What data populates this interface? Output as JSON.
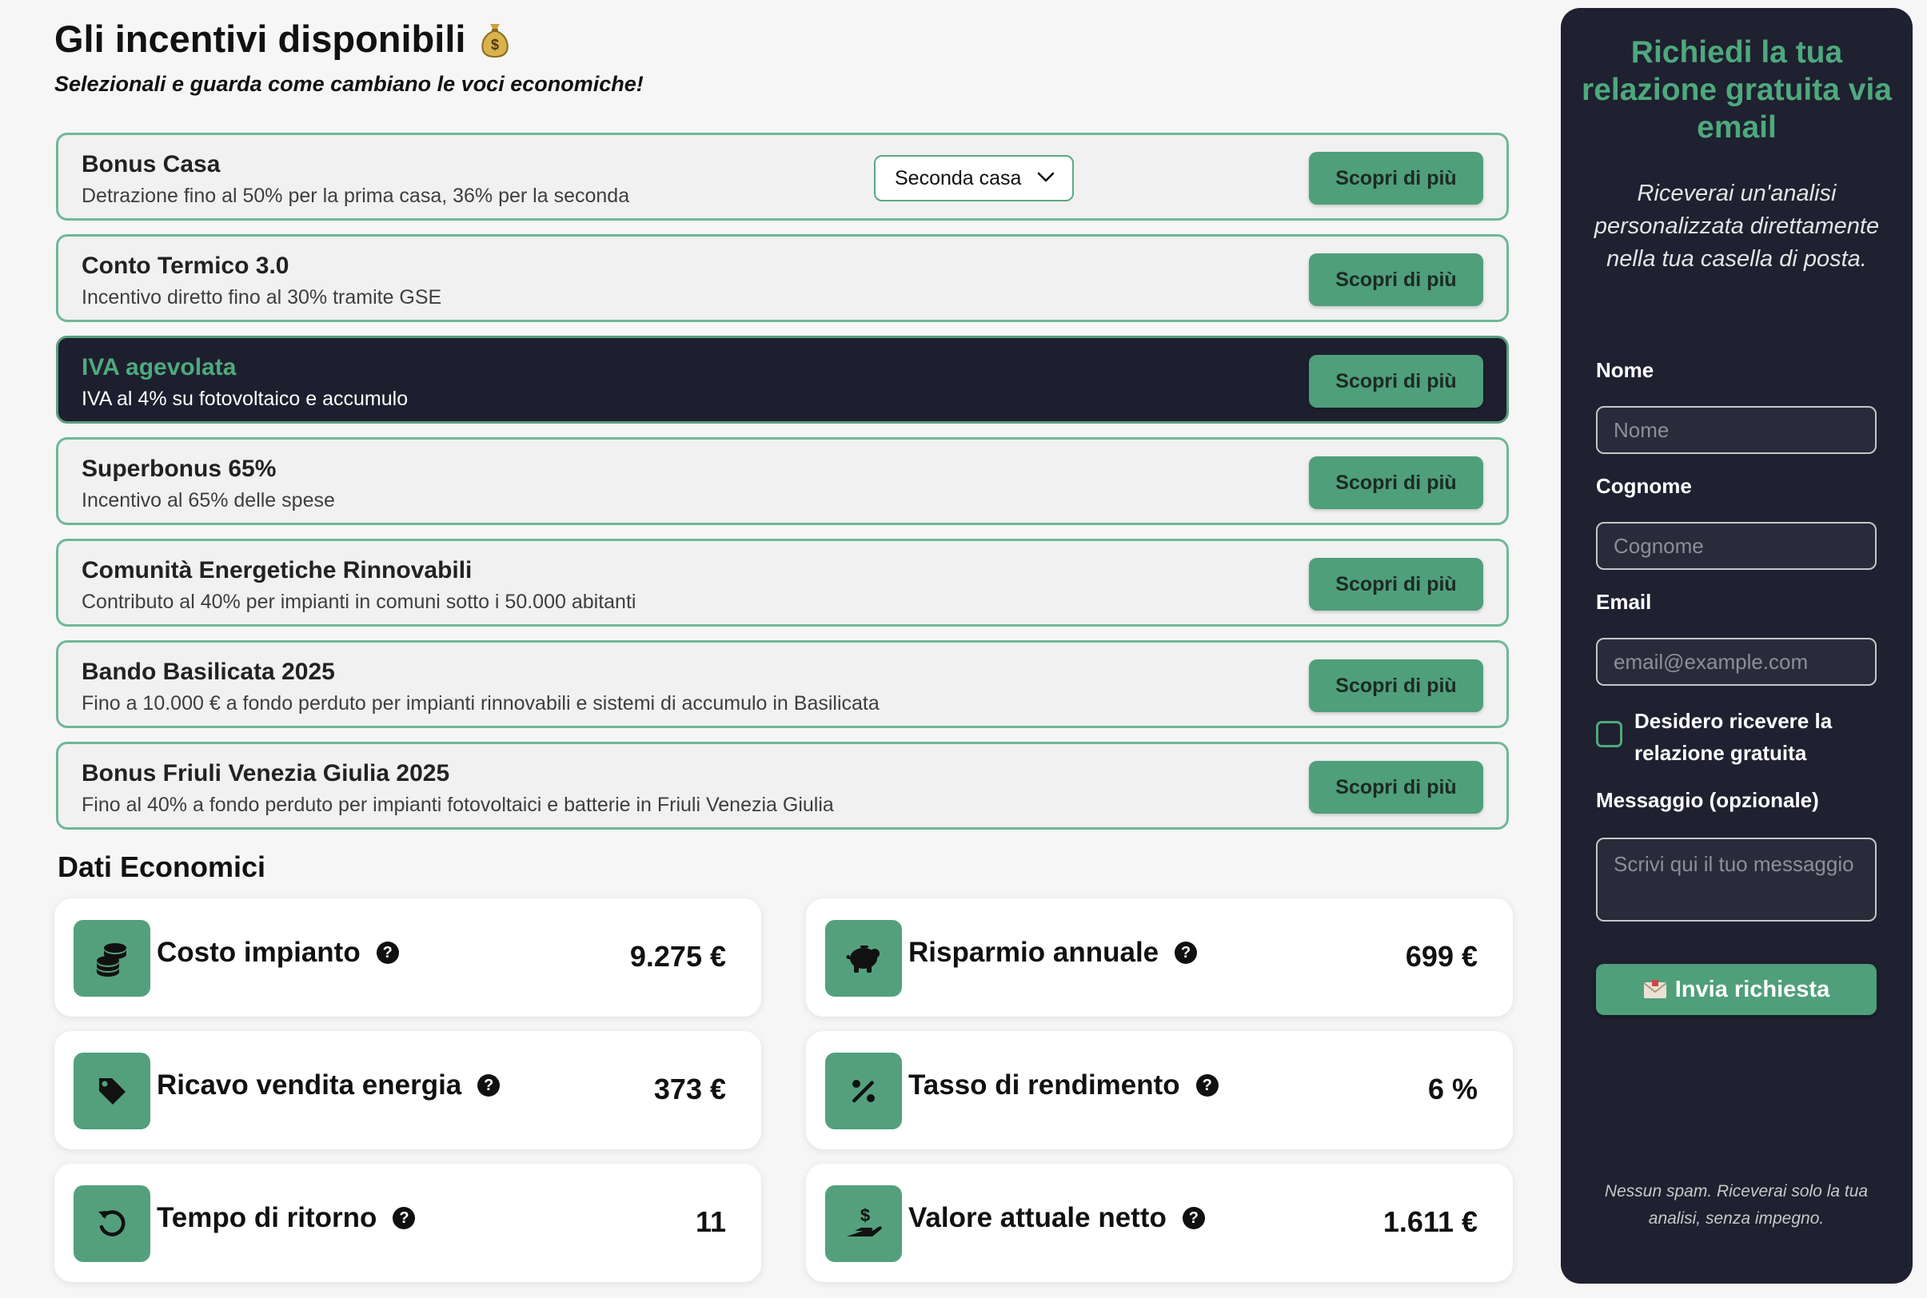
{
  "header": {
    "title": "Gli incentivi disponibili",
    "subtitle": "Selezionali e guarda come cambiano le voci economiche!"
  },
  "incentives": [
    {
      "title": "Bonus Casa",
      "description": "Detrazione fino al 50% per la prima casa, 36% per la seconda",
      "button": "Scopri di più",
      "dropdown": "Seconda casa",
      "active": false
    },
    {
      "title": "Conto Termico 3.0",
      "description": "Incentivo diretto fino al 30% tramite GSE",
      "button": "Scopri di più",
      "active": false
    },
    {
      "title": "IVA agevolata",
      "description": "IVA al 4% su fotovoltaico e accumulo",
      "button": "Scopri di più",
      "active": true
    },
    {
      "title": "Superbonus 65%",
      "description": "Incentivo al 65% delle spese",
      "button": "Scopri di più",
      "active": false
    },
    {
      "title": "Comunità Energetiche Rinnovabili",
      "description": "Contributo al 40% per impianti in comuni sotto i 50.000 abitanti",
      "button": "Scopri di più",
      "active": false
    },
    {
      "title": "Bando Basilicata 2025",
      "description": "Fino a 10.000 € a fondo perduto per impianti rinnovabili e sistemi di accumulo in Basilicata",
      "button": "Scopri di più",
      "active": false
    },
    {
      "title": "Bonus Friuli Venezia Giulia 2025",
      "description": "Fino al 40% a fondo perduto per impianti fotovoltaici e batterie in Friuli Venezia Giulia",
      "button": "Scopri di più",
      "active": false
    }
  ],
  "dati": {
    "title": "Dati Economici",
    "cards": [
      {
        "label": "Costo impianto",
        "value": "9.275 €",
        "icon": "coins-icon"
      },
      {
        "label": "Risparmio annuale",
        "value": "699 €",
        "icon": "piggy-bank-icon"
      },
      {
        "label": "Ricavo vendita energia",
        "value": "373 €",
        "icon": "tag-icon"
      },
      {
        "label": "Tasso di rendimento",
        "value": "6 %",
        "icon": "percent-icon"
      },
      {
        "label": "Tempo di ritorno",
        "value": "11",
        "icon": "rotate-left-icon"
      },
      {
        "label": "Valore attuale netto",
        "value": "1.611 €",
        "icon": "hand-dollar-icon"
      }
    ]
  },
  "sidebar": {
    "title": "Richiedi la tua relazione gratuita via email",
    "intro": "Riceverai un'analisi personalizzata direttamente nella tua casella di posta.",
    "nome_label": "Nome",
    "nome_placeholder": "Nome",
    "cognome_label": "Cognome",
    "cognome_placeholder": "Cognome",
    "email_label": "Email",
    "email_placeholder": "email@example.com",
    "checkbox_label": "Desidero ricevere la relazione gratuita",
    "message_label": "Messaggio (opzionale)",
    "message_placeholder": "Scrivi qui il tuo messaggio",
    "submit": "Invia richiesta",
    "footer": "Nessun spam. Riceverai solo la tua analisi, senza impegno."
  },
  "colors": {
    "accent": "#4f9f7a",
    "dark": "#1f2030",
    "background": "#f6f6f6"
  }
}
